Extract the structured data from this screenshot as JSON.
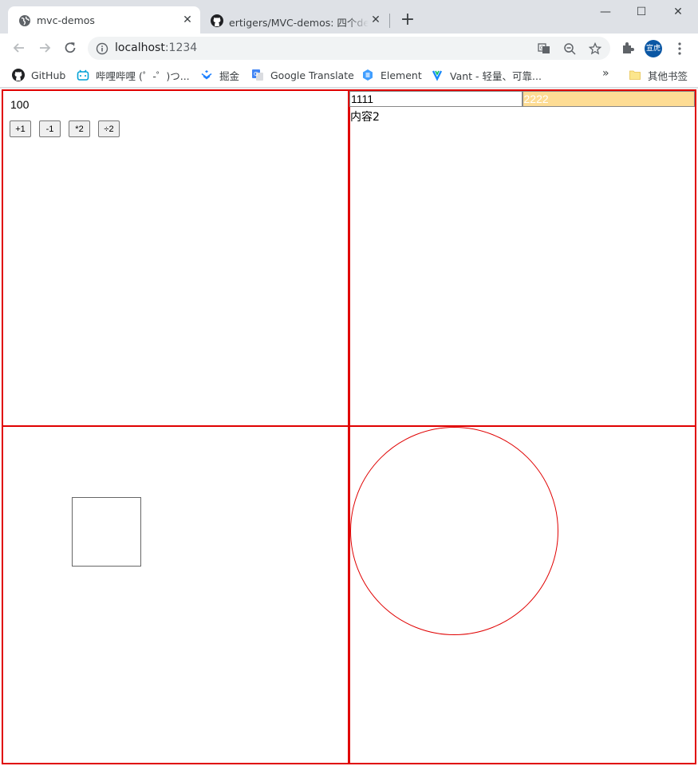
{
  "browser": {
    "tabs": [
      {
        "title": "mvc-demos",
        "icon": "globe-icon",
        "active": true
      },
      {
        "title": "ertigers/MVC-demos: 四个demo",
        "icon": "github-icon",
        "active": false
      }
    ],
    "url": {
      "host": "localhost",
      "port": ":1234"
    },
    "avatar_text": "宣虎"
  },
  "bookmarks": [
    {
      "label": "GitHub",
      "icon": "github-icon"
    },
    {
      "label": "哔哩哔哩 (゜-゜)つ...",
      "icon": "bilibili-icon"
    },
    {
      "label": "掘金",
      "icon": "juejin-icon"
    },
    {
      "label": "Google Translate",
      "icon": "google-translate-icon"
    },
    {
      "label": "Element",
      "icon": "element-icon"
    },
    {
      "label": "Vant - 轻量、可靠...",
      "icon": "vant-icon"
    }
  ],
  "bookmarks_more": "»",
  "other_bookmarks": "其他书签",
  "app1": {
    "value": "100",
    "buttons": [
      "+1",
      "-1",
      "*2",
      "÷2"
    ]
  },
  "app2": {
    "tabs": [
      "1111",
      "2222"
    ],
    "selected_tab": 1,
    "content": "内容2"
  },
  "colors": {
    "border": "#e00000",
    "selected_tab_bg": "#fddc94",
    "avatar_bg": "#0b57a4"
  }
}
